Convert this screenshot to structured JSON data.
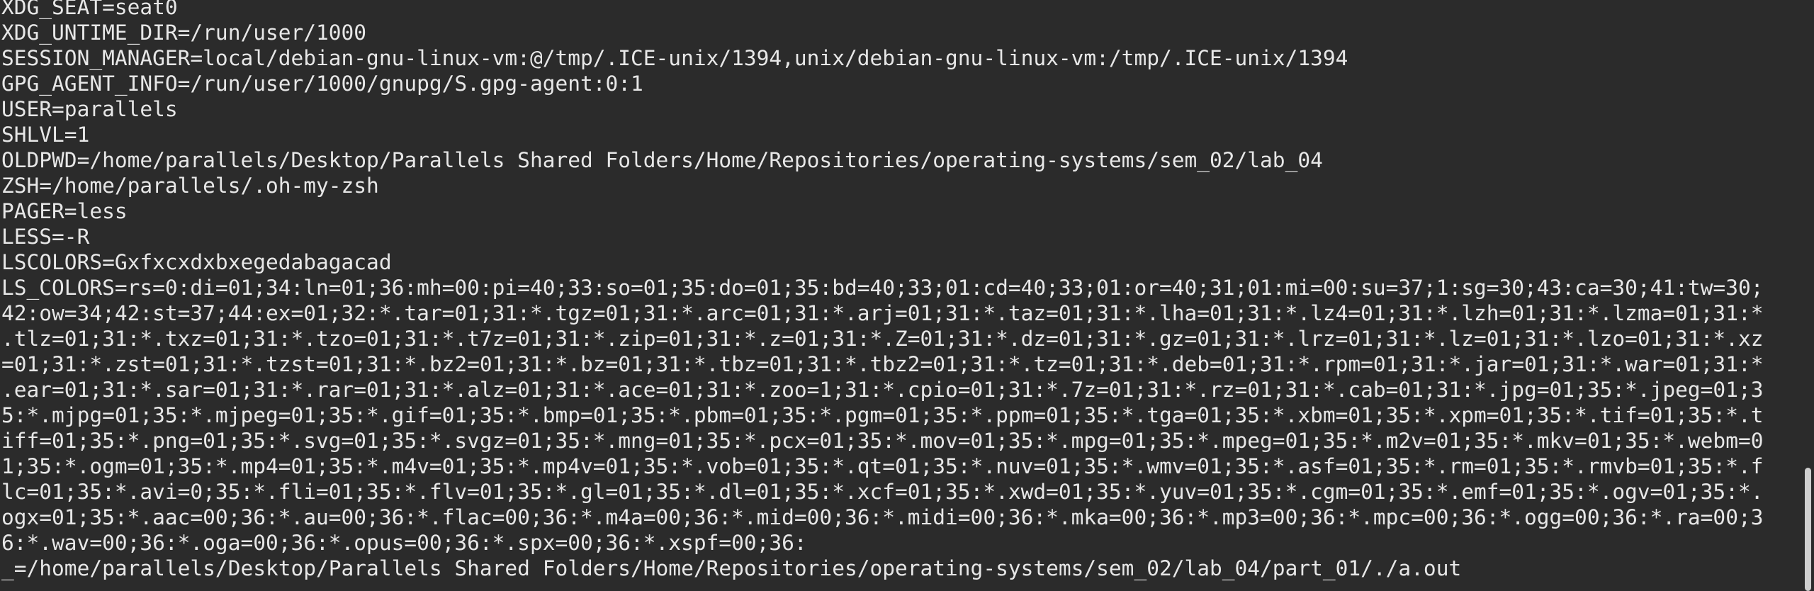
{
  "terminal": {
    "lines": [
      "XDG_SEAT=seat0",
      "XDG_UNTIME_DIR=/run/user/1000",
      "SESSION_MANAGER=local/debian-gnu-linux-vm:@/tmp/.ICE-unix/1394,unix/debian-gnu-linux-vm:/tmp/.ICE-unix/1394",
      "GPG_AGENT_INFO=/run/user/1000/gnupg/S.gpg-agent:0:1",
      "USER=parallels",
      "SHLVL=1",
      "OLDPWD=/home/parallels/Desktop/Parallels Shared Folders/Home/Repositories/operating-systems/sem_02/lab_04",
      "ZSH=/home/parallels/.oh-my-zsh",
      "PAGER=less",
      "LESS=-R",
      "LSCOLORS=Gxfxcxdxbxegedabagacad",
      "LS_COLORS=rs=0:di=01;34:ln=01;36:mh=00:pi=40;33:so=01;35:do=01;35:bd=40;33;01:cd=40;33;01:or=40;31;01:mi=00:su=37;1:sg=30;43:ca=30;41:tw=30;",
      "42:ow=34;42:st=37;44:ex=01;32:*.tar=01;31:*.tgz=01;31:*.arc=01;31:*.arj=01;31:*.taz=01;31:*.lha=01;31:*.lz4=01;31:*.lzh=01;31:*.lzma=01;31:*",
      ".tlz=01;31:*.txz=01;31:*.tzo=01;31:*.t7z=01;31:*.zip=01;31:*.z=01;31:*.Z=01;31:*.dz=01;31:*.gz=01;31:*.lrz=01;31:*.lz=01;31:*.lzo=01;31:*.xz",
      "=01;31:*.zst=01;31:*.tzst=01;31:*.bz2=01;31:*.bz=01;31:*.tbz=01;31:*.tbz2=01;31:*.tz=01;31:*.deb=01;31:*.rpm=01;31:*.jar=01;31:*.war=01;31:*",
      ".ear=01;31:*.sar=01;31:*.rar=01;31:*.alz=01;31:*.ace=01;31:*.zoo=1;31:*.cpio=01;31:*.7z=01;31:*.rz=01;31:*.cab=01;31:*.jpg=01;35:*.jpeg=01;3",
      "5:*.mjpg=01;35:*.mjpeg=01;35:*.gif=01;35:*.bmp=01;35:*.pbm=01;35:*.pgm=01;35:*.ppm=01;35:*.tga=01;35:*.xbm=01;35:*.xpm=01;35:*.tif=01;35:*.t",
      "iff=01;35:*.png=01;35:*.svg=01;35:*.svgz=01;35:*.mng=01;35:*.pcx=01;35:*.mov=01;35:*.mpg=01;35:*.mpeg=01;35:*.m2v=01;35:*.mkv=01;35:*.webm=0",
      "1;35:*.ogm=01;35:*.mp4=01;35:*.m4v=01;35:*.mp4v=01;35:*.vob=01;35:*.qt=01;35:*.nuv=01;35:*.wmv=01;35:*.asf=01;35:*.rm=01;35:*.rmvb=01;35:*.f",
      "lc=01;35:*.avi=0;35:*.fli=01;35:*.flv=01;35:*.gl=01;35:*.dl=01;35:*.xcf=01;35:*.xwd=01;35:*.yuv=01;35:*.cgm=01;35:*.emf=01;35:*.ogv=01;35:*.",
      "ogx=01;35:*.aac=00;36:*.au=00;36:*.flac=00;36:*.m4a=00;36:*.mid=00;36:*.midi=00;36:*.mka=00;36:*.mp3=00;36:*.mpc=00;36:*.ogg=00;36:*.ra=00;3",
      "6:*.wav=00;36:*.oga=00;36:*.opus=00;36:*.spx=00;36:*.xspf=00;36:",
      "_=/home/parallels/Desktop/Parallels Shared Folders/Home/Repositories/operating-systems/sem_02/lab_04/part_01/./a.out"
    ]
  },
  "colors": {
    "background": "#2b2b2b",
    "foreground": "#e7e7e7",
    "scrollbar_thumb": "#cfcfcf"
  },
  "scrollbar": {
    "position_fraction": 1.0
  }
}
